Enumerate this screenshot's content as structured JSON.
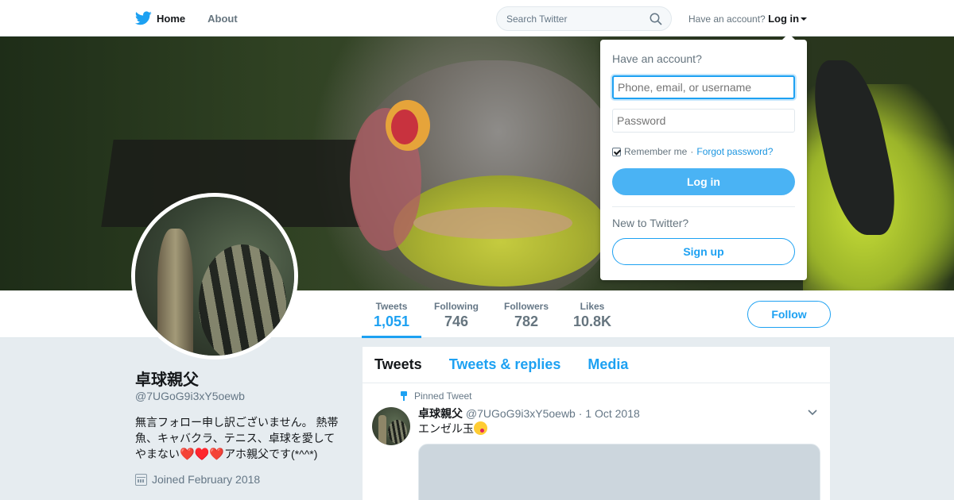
{
  "nav": {
    "home_label": "Home",
    "about_label": "About",
    "search_placeholder": "Search Twitter",
    "account_prompt": "Have an account?",
    "login_label": "Log in"
  },
  "profile": {
    "name": "卓球親父",
    "handle": "@7UGoG9i3xY5oewb",
    "bio_text": "無言フォロー申し訳ございません。 熱帯魚、キャバクラ、テニス、卓球を愛してやまない",
    "bio_suffix": "アホ親父です(*^^*)",
    "bio_hearts": [
      "❤️",
      "♥️",
      "❤️"
    ],
    "joined": "Joined February 2018",
    "follow_label": "Follow"
  },
  "stats": [
    {
      "label": "Tweets",
      "value": "1,051",
      "active": true
    },
    {
      "label": "Following",
      "value": "746",
      "active": false
    },
    {
      "label": "Followers",
      "value": "782",
      "active": false
    },
    {
      "label": "Likes",
      "value": "10.8K",
      "active": false
    }
  ],
  "timeline": {
    "tabs": [
      {
        "label": "Tweets",
        "active": true
      },
      {
        "label": "Tweets & replies",
        "active": false
      },
      {
        "label": "Media",
        "active": false
      }
    ],
    "pinned_label": "Pinned Tweet",
    "tweet": {
      "author_name": "卓球親父",
      "author_handle": "@7UGoG9i3xY5oewb",
      "date": "· 1 Oct 2018",
      "text": "エンゼル玉",
      "emoji": "face-savoring-food"
    }
  },
  "login_dropdown": {
    "title": "Have an account?",
    "username_placeholder": "Phone, email, or username",
    "password_placeholder": "Password",
    "remember_label": "Remember me",
    "separator": "·",
    "forgot_label": "Forgot password?",
    "login_button": "Log in",
    "new_prompt": "New to Twitter?",
    "signup_button": "Sign up"
  },
  "colors": {
    "accent": "#1da1f2",
    "login_button": "#4ab3f4",
    "heart": "#e0245e"
  }
}
